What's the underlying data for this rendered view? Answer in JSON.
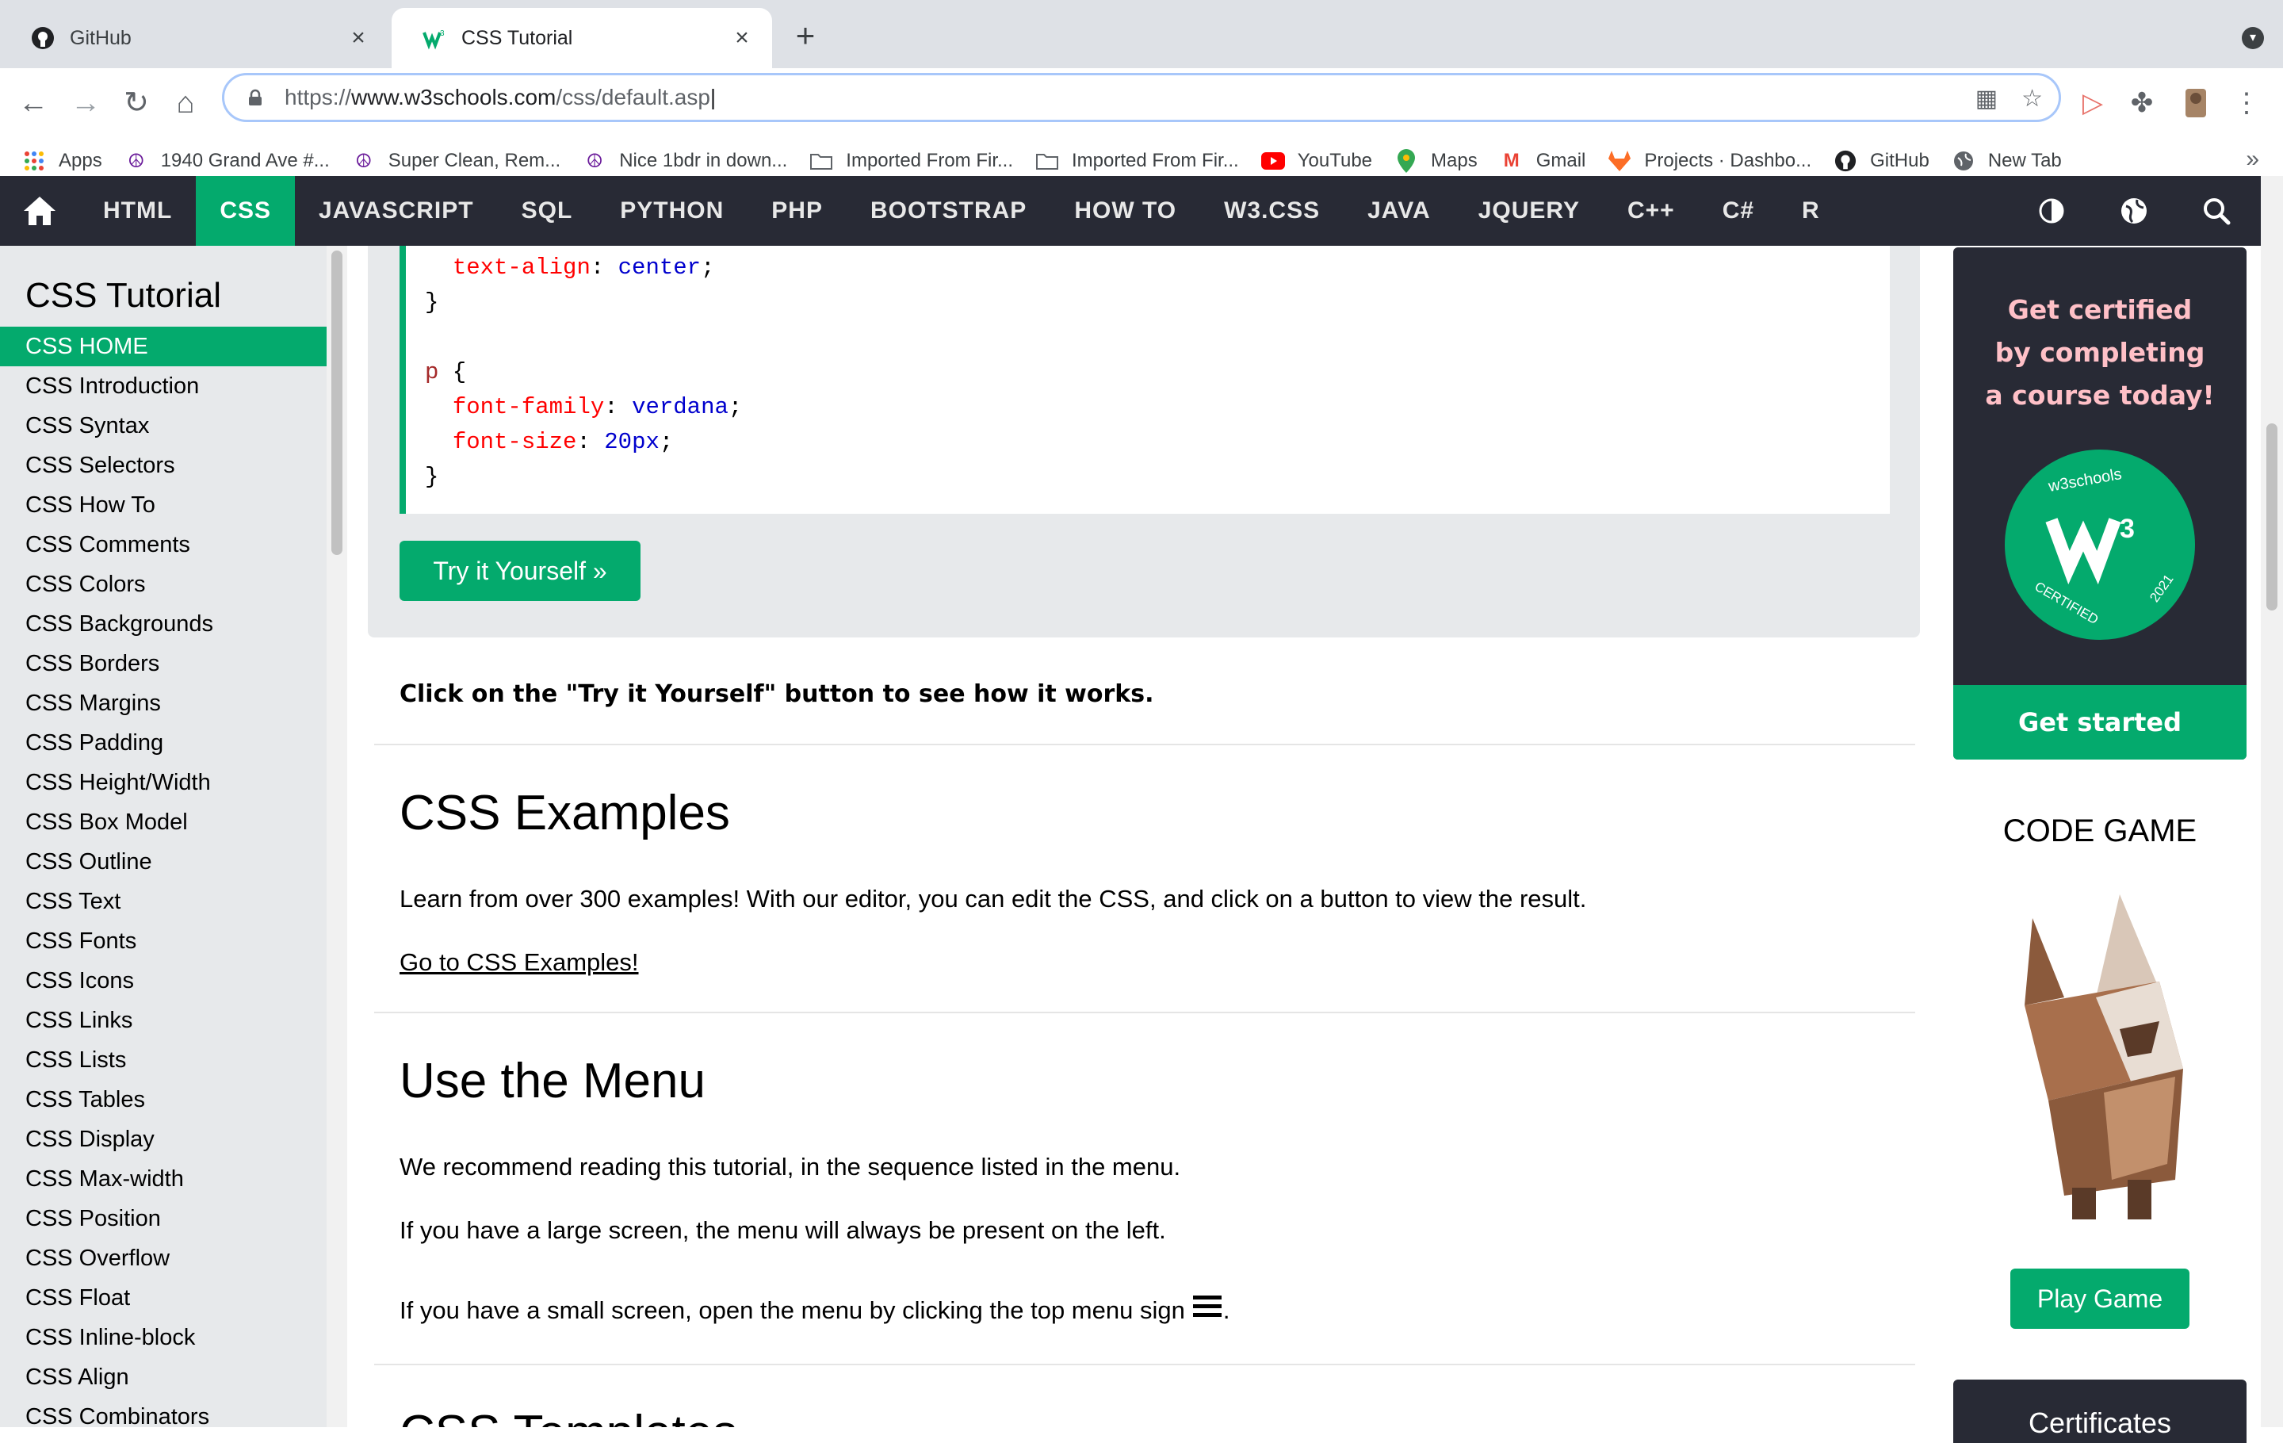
{
  "browser": {
    "tabs": [
      {
        "title": "GitHub",
        "icon": "github-icon",
        "active": false
      },
      {
        "title": "CSS Tutorial",
        "icon": "w3schools-icon",
        "active": true
      }
    ],
    "url_prefix": "https://",
    "url_host": "www.w3schools.com",
    "url_path": "/css/default.asp",
    "bookmarks": [
      {
        "label": "Apps",
        "icon": "apps-grid-icon"
      },
      {
        "label": "1940 Grand Ave #...",
        "icon": "peace-icon"
      },
      {
        "label": "Super Clean, Rem...",
        "icon": "peace-icon"
      },
      {
        "label": "Nice 1bdr in down...",
        "icon": "peace-icon"
      },
      {
        "label": "Imported From Fir...",
        "icon": "folder-icon"
      },
      {
        "label": "Imported From Fir...",
        "icon": "folder-icon"
      },
      {
        "label": "YouTube",
        "icon": "youtube-icon"
      },
      {
        "label": "Maps",
        "icon": "maps-pin-icon"
      },
      {
        "label": "Gmail",
        "icon": "gmail-icon"
      },
      {
        "label": "Projects · Dashbo...",
        "icon": "gitlab-icon"
      },
      {
        "label": "GitHub",
        "icon": "github-icon"
      },
      {
        "label": "New Tab",
        "icon": "globe-icon"
      }
    ],
    "bookmarks_more": "»"
  },
  "w3nav": {
    "items": [
      "HTML",
      "CSS",
      "JAVASCRIPT",
      "SQL",
      "PYTHON",
      "PHP",
      "BOOTSTRAP",
      "HOW TO",
      "W3.CSS",
      "JAVA",
      "JQUERY",
      "C++",
      "C#",
      "R"
    ],
    "active": "CSS"
  },
  "sidebar": {
    "title": "CSS Tutorial",
    "items": [
      "CSS HOME",
      "CSS Introduction",
      "CSS Syntax",
      "CSS Selectors",
      "CSS How To",
      "CSS Comments",
      "CSS Colors",
      "CSS Backgrounds",
      "CSS Borders",
      "CSS Margins",
      "CSS Padding",
      "CSS Height/Width",
      "CSS Box Model",
      "CSS Outline",
      "CSS Text",
      "CSS Fonts",
      "CSS Icons",
      "CSS Links",
      "CSS Lists",
      "CSS Tables",
      "CSS Display",
      "CSS Max-width",
      "CSS Position",
      "CSS Overflow",
      "CSS Float",
      "CSS Inline-block",
      "CSS Align",
      "CSS Combinators"
    ]
  },
  "main": {
    "code": {
      "line1_prop": "text-align",
      "line1_val": "center",
      "close1": "}",
      "selector": "p",
      "line2_prop": "font-family",
      "line2_val": "verdana",
      "line3_prop": "font-size",
      "line3_val": "20px",
      "close2": "}"
    },
    "try_button": "Try it Yourself »",
    "note": "Click on the \"Try it Yourself\" button to see how it works.",
    "examples_heading": "CSS Examples",
    "examples_text": "Learn from over 300 examples! With our editor, you can edit the CSS, and click on a button to view the result.",
    "examples_link": "Go to CSS Examples!",
    "menu_heading": "Use the Menu",
    "menu_p1": "We recommend reading this tutorial, in the sequence listed in the menu.",
    "menu_p2": "If you have a large screen, the menu will always be present on the left.",
    "menu_p3": "If you have a small screen, open the menu by clicking the top menu sign",
    "menu_p3_end": ".",
    "next_heading": "CSS Templates"
  },
  "right": {
    "cert_line1": "Get certified",
    "cert_line2": "by completing",
    "cert_line3": "a course today!",
    "badge_top": "w3schools",
    "badge_bottom_left": "CERTIFIED",
    "badge_year": "2021",
    "get_started": "Get started",
    "code_game": "CODE GAME",
    "play_game": "Play Game",
    "certificates": "Certificates"
  },
  "colors": {
    "accent": "#04aa6d",
    "nav_bg": "#282a35",
    "sidebar_bg": "#e7e9eb",
    "cert_text": "#ffc0c7"
  }
}
